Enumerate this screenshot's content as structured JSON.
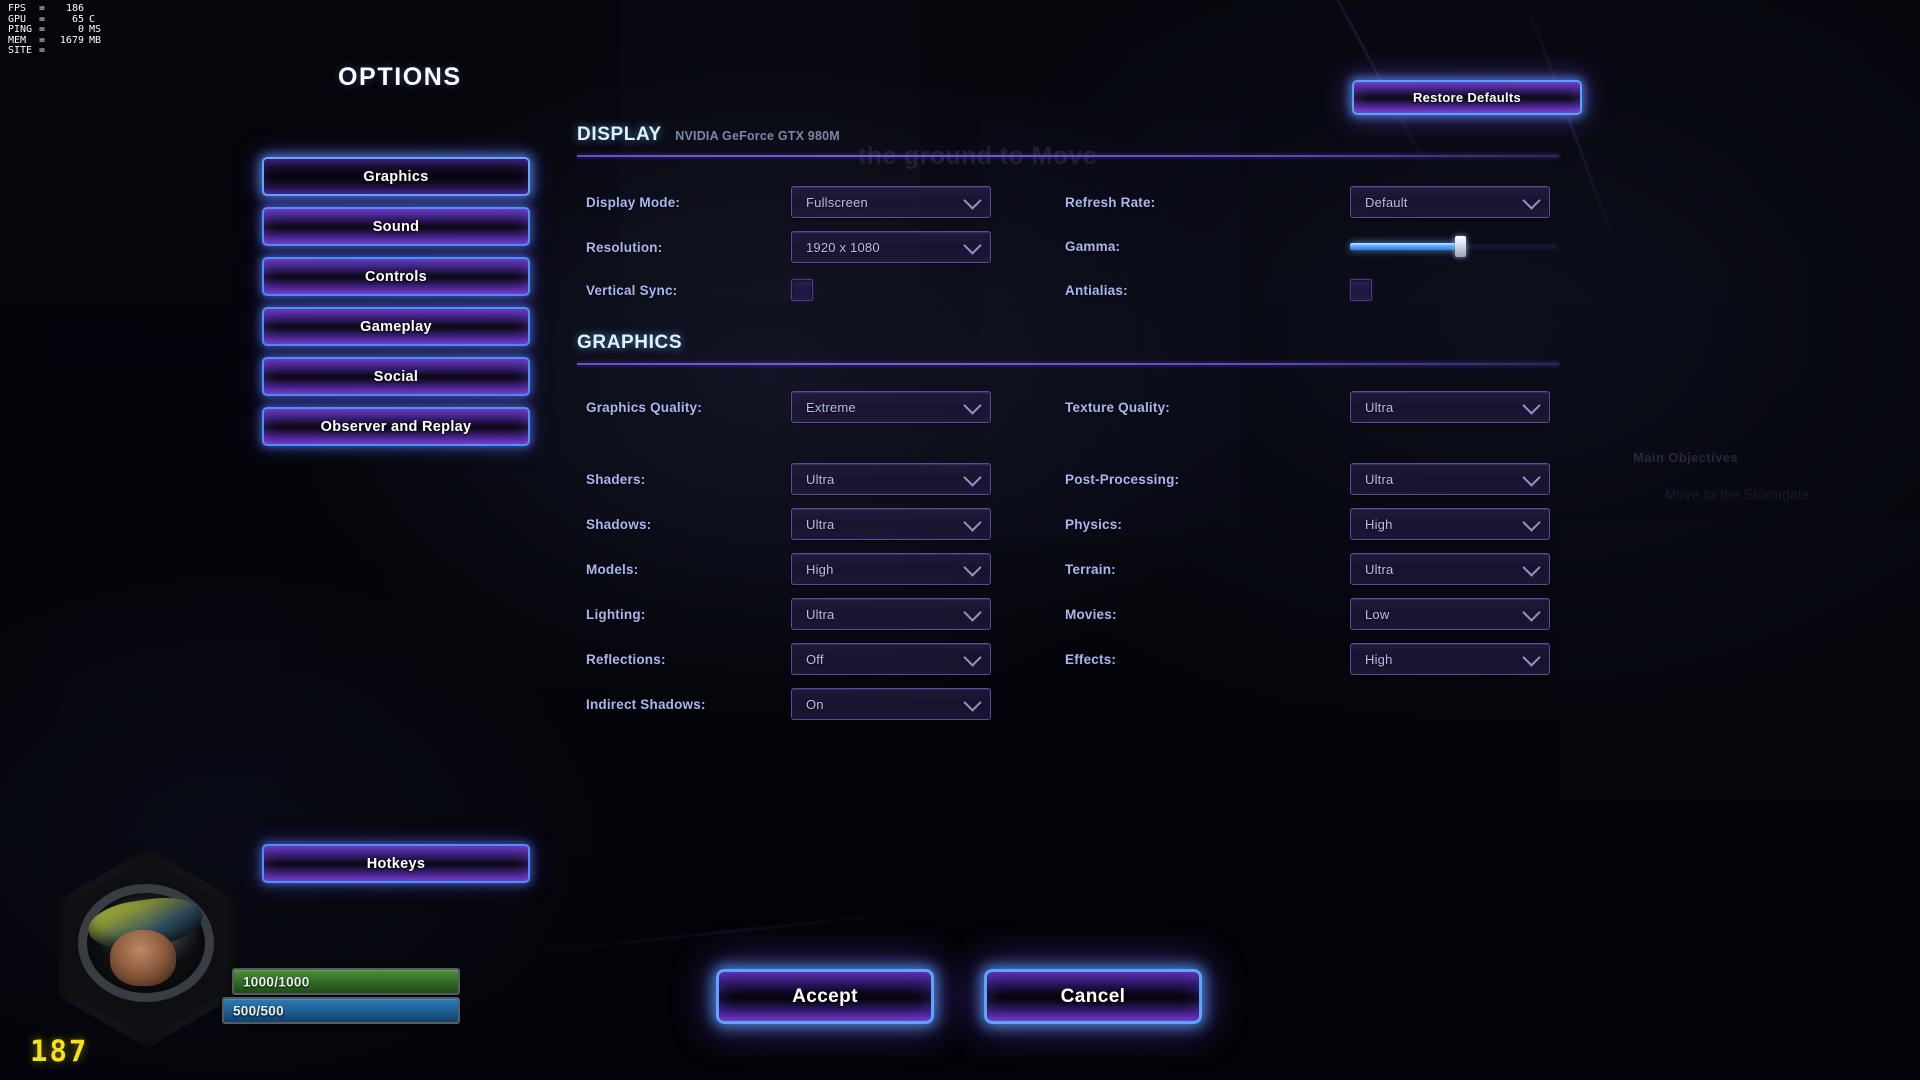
{
  "perf_overlay": {
    "rows": [
      {
        "key": "FPS",
        "eq": "=",
        "value": "186",
        "unit": ""
      },
      {
        "key": "GPU",
        "eq": "=",
        "value": "65",
        "unit": "C"
      },
      {
        "key": "PING",
        "eq": "=",
        "value": "0",
        "unit": "MS"
      },
      {
        "key": "MEM",
        "eq": "=",
        "value": "1679",
        "unit": "MB"
      },
      {
        "key": "SITE",
        "eq": "=",
        "value": "",
        "unit": ""
      }
    ]
  },
  "page": {
    "title": "OPTIONS"
  },
  "sidebar": {
    "items": [
      {
        "label": "Graphics",
        "selected": true
      },
      {
        "label": "Sound",
        "selected": false
      },
      {
        "label": "Controls",
        "selected": false
      },
      {
        "label": "Gameplay",
        "selected": false
      },
      {
        "label": "Social",
        "selected": false
      },
      {
        "label": "Observer and Replay",
        "selected": false
      }
    ],
    "hotkeys_label": "Hotkeys"
  },
  "toolbar": {
    "restore_defaults_label": "Restore Defaults"
  },
  "display_section": {
    "title": "DISPLAY",
    "subtitle": "NVIDIA GeForce GTX 980M",
    "display_mode": {
      "label": "Display Mode:",
      "value": "Fullscreen"
    },
    "resolution": {
      "label": "Resolution:",
      "value": "1920 x 1080"
    },
    "vertical_sync": {
      "label": "Vertical Sync:",
      "checked": false
    },
    "refresh_rate": {
      "label": "Refresh Rate:",
      "value": "Default"
    },
    "gamma": {
      "label": "Gamma:",
      "percent": 53
    },
    "antialias": {
      "label": "Antialias:",
      "checked": false
    }
  },
  "graphics_section": {
    "title": "GRAPHICS",
    "graphics_quality": {
      "label": "Graphics Quality:",
      "value": "Extreme"
    },
    "texture_quality": {
      "label": "Texture Quality:",
      "value": "Ultra"
    },
    "left_rows": [
      {
        "label": "Shaders:",
        "value": "Ultra"
      },
      {
        "label": "Shadows:",
        "value": "Ultra"
      },
      {
        "label": "Models:",
        "value": "High"
      },
      {
        "label": "Lighting:",
        "value": "Ultra"
      },
      {
        "label": "Reflections:",
        "value": "Off"
      },
      {
        "label": "Indirect Shadows:",
        "value": "On"
      }
    ],
    "right_rows": [
      {
        "label": "Post-Processing:",
        "value": "Ultra"
      },
      {
        "label": "Physics:",
        "value": "High"
      },
      {
        "label": "Terrain:",
        "value": "Ultra"
      },
      {
        "label": "Movies:",
        "value": "Low"
      },
      {
        "label": "Effects:",
        "value": "High"
      }
    ]
  },
  "footer": {
    "accept_label": "Accept",
    "cancel_label": "Cancel"
  },
  "hud": {
    "health": "1000/1000",
    "shields": "500/500",
    "supply_count": "187"
  },
  "background_text": {
    "move_hint": "the ground to Move",
    "objectives_title": "Main Objectives",
    "objective_1": "Move to the Stormgate"
  },
  "colors": {
    "accent_blue": "#5ba4ff",
    "accent_purple": "#7a3fd0",
    "section_title": "#dff2ff",
    "field_label": "#aab6f0",
    "dropdown_value": "#b9bde6",
    "hp_green": "#3f7f2e",
    "shield_blue": "#1d5c92",
    "supply_yellow": "#f5e31a"
  }
}
